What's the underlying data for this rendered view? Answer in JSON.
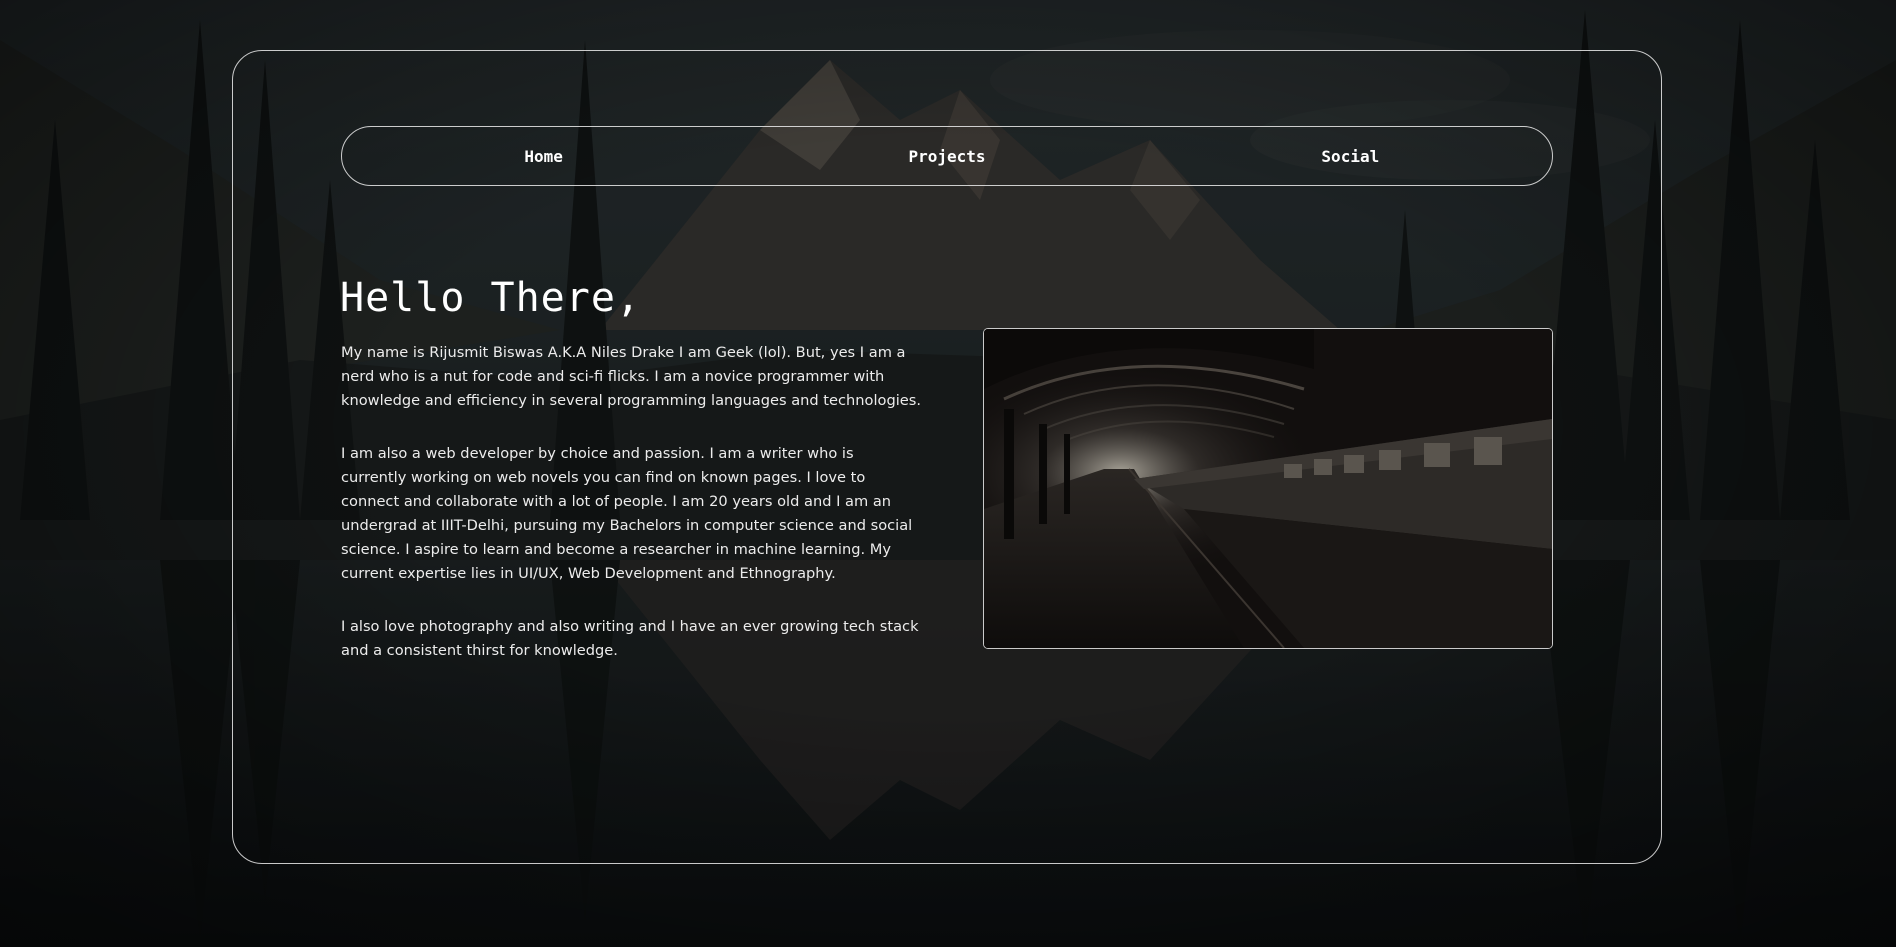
{
  "nav": {
    "items": [
      {
        "label": "Home"
      },
      {
        "label": "Projects"
      },
      {
        "label": "Social"
      }
    ]
  },
  "hero": {
    "heading": "Hello There,",
    "paragraphs": [
      "My name is Rijusmit Biswas A.K.A Niles Drake I am Geek (lol). But, yes I am a nerd who is a nut for code and sci-fi flicks. I am a novice programmer with knowledge and efficiency in several programming languages and technologies.",
      "I am also a web developer by choice and passion. I am a writer who is currently working on web novels you can find on known pages. I love to connect and collaborate with a lot of people. I am 20 years old and I am an undergrad at IIIT-Delhi, pursuing my Bachelors in computer science and social science. I aspire to learn and become a researcher in machine learning. My current expertise lies in UI/UX, Web Development and Ethnography.",
      "I also love photography and also writing and I have an ever growing tech stack and a consistent thirst for knowledge."
    ]
  },
  "colors": {
    "text": "#ffffff",
    "border": "#ebebeb",
    "overlay": "#0d1012"
  }
}
